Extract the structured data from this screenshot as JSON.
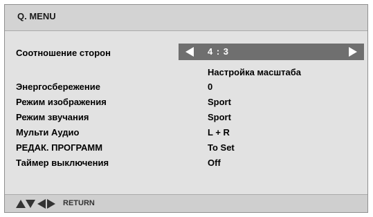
{
  "menu": {
    "title": "Q. MENU"
  },
  "selected_item": {
    "label": "Соотношение сторон",
    "value": "4 : 3",
    "sub_value": "Настройка масштаба"
  },
  "items": [
    {
      "label": "Энергосбережение",
      "value": "0"
    },
    {
      "label": "Режим изображения",
      "value": "Sport"
    },
    {
      "label": "Режим звучания",
      "value": "Sport"
    },
    {
      "label": "Мульти Аудио",
      "value": "L + R"
    },
    {
      "label": "РЕДАК. ПРОГРАММ",
      "value": "To Set"
    },
    {
      "label": "Таймер выключения",
      "value": "Off"
    }
  ],
  "footer": {
    "nav_icons": [
      "up-arrow-icon",
      "down-arrow-icon",
      "left-arrow-icon",
      "right-arrow-icon"
    ],
    "return_label": "RETURN"
  },
  "colors": {
    "panel_bg": "#e2e2e2",
    "selection_bg": "#6f6f6f",
    "text": "#000000"
  }
}
